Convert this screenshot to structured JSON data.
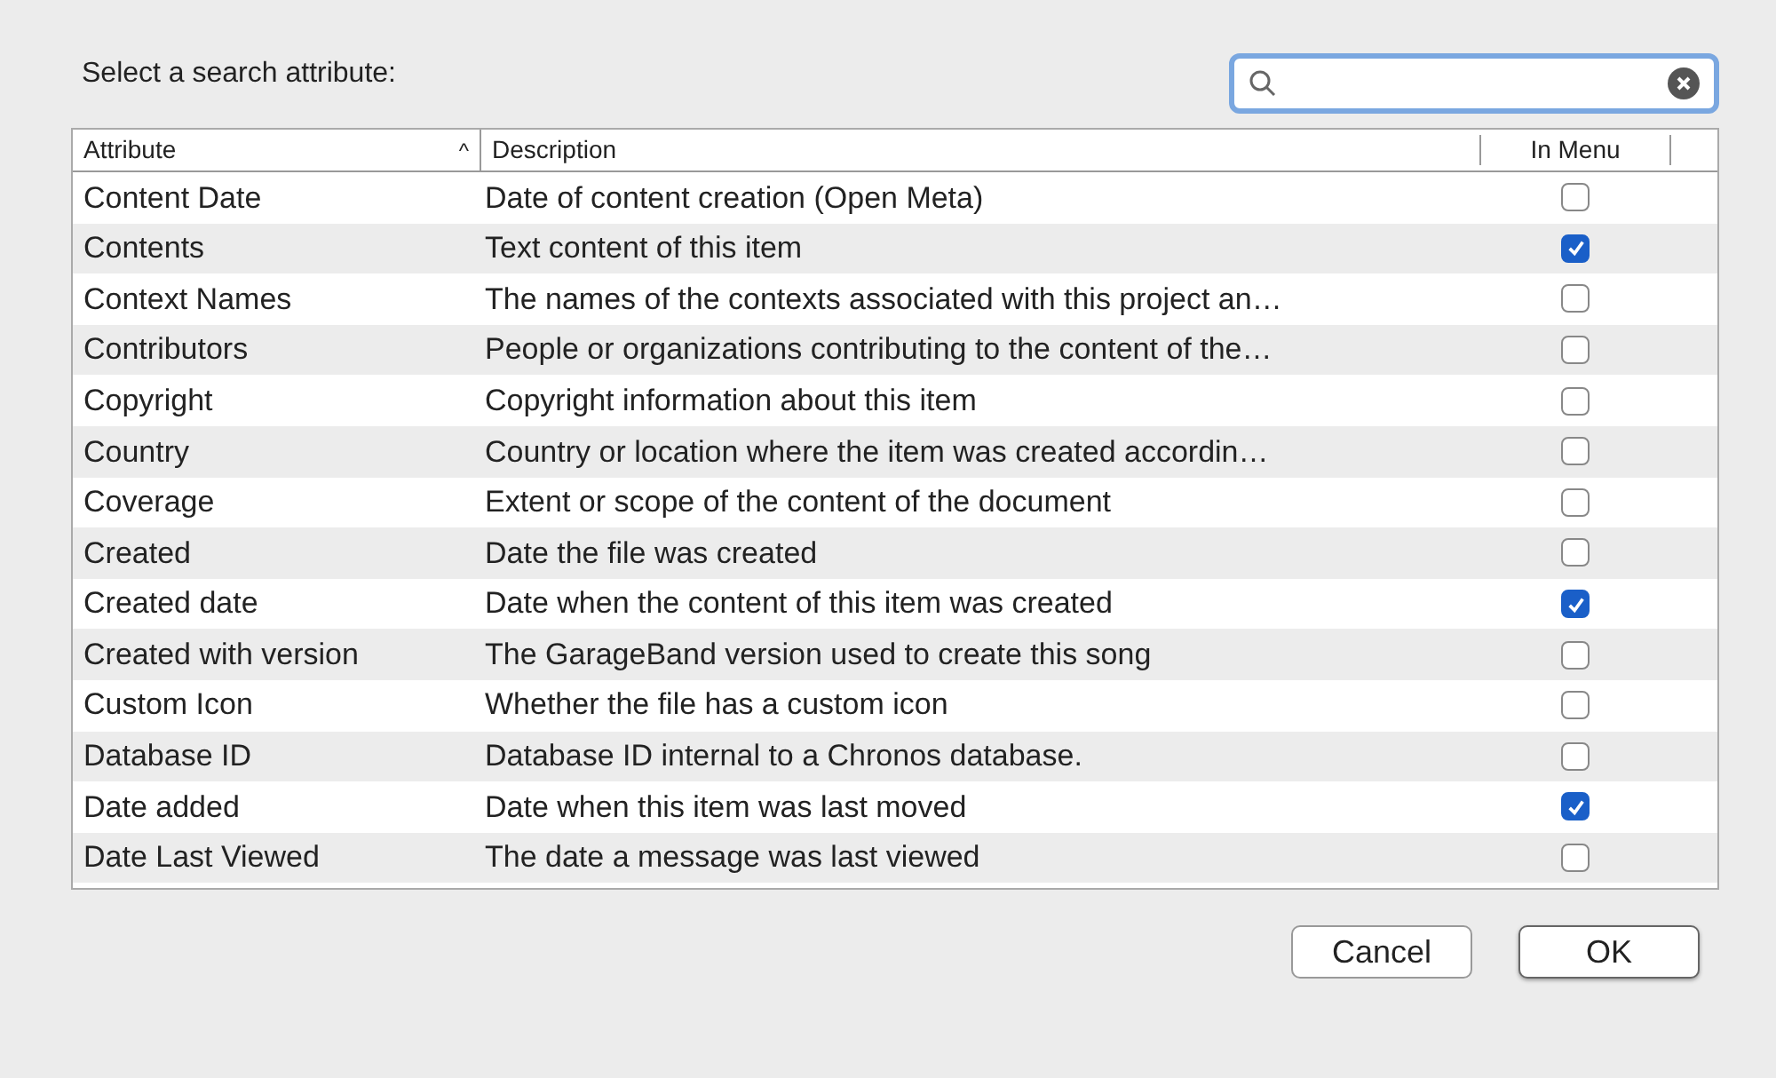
{
  "prompt": "Select a search attribute:",
  "table": {
    "columns": [
      {
        "label": "Attribute",
        "sort_glyph": "^"
      },
      {
        "label": "Description"
      },
      {
        "label": "In Menu"
      }
    ],
    "rows": [
      {
        "attribute": "Content Date",
        "description": "Date of content creation (Open Meta)",
        "in_menu": false
      },
      {
        "attribute": "Contents",
        "description": "Text content of this item",
        "in_menu": true
      },
      {
        "attribute": "Context Names",
        "description": "The names of the contexts associated with this project an…",
        "in_menu": false
      },
      {
        "attribute": "Contributors",
        "description": "People or organizations contributing to the content of the…",
        "in_menu": false
      },
      {
        "attribute": "Copyright",
        "description": "Copyright information about this item",
        "in_menu": false
      },
      {
        "attribute": "Country",
        "description": "Country or location where the item was created accordin…",
        "in_menu": false
      },
      {
        "attribute": "Coverage",
        "description": "Extent or scope of the content of the document",
        "in_menu": false
      },
      {
        "attribute": "Created",
        "description": "Date the file was created",
        "in_menu": false
      },
      {
        "attribute": "Created date",
        "description": "Date when the content of this item was created",
        "in_menu": true
      },
      {
        "attribute": "Created with version",
        "description": "The GarageBand version used to create this song",
        "in_menu": false
      },
      {
        "attribute": "Custom Icon",
        "description": "Whether the file has a custom icon",
        "in_menu": false
      },
      {
        "attribute": "Database ID",
        "description": "Database ID internal to a Chronos database.",
        "in_menu": false
      },
      {
        "attribute": "Date added",
        "description": "Date when this item was last moved",
        "in_menu": true
      },
      {
        "attribute": "Date Last Viewed",
        "description": "The date a message was last viewed",
        "in_menu": false
      }
    ]
  },
  "buttons": [
    {
      "label": "Cancel",
      "default": false
    },
    {
      "label": "OK",
      "default": true
    }
  ]
}
